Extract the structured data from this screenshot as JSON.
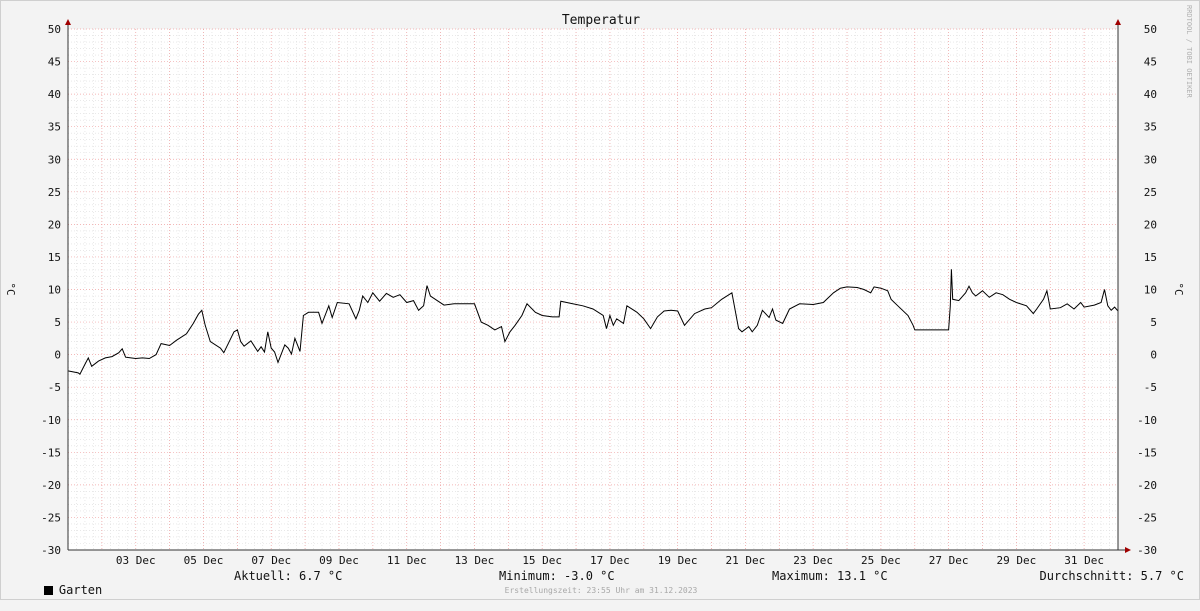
{
  "chart_data": {
    "type": "line",
    "title": "Temperatur",
    "ylabel": "°C",
    "ylim": [
      -30,
      50
    ],
    "yticks": [
      50,
      45,
      40,
      35,
      30,
      25,
      20,
      15,
      10,
      5,
      0,
      -5,
      -10,
      -15,
      -20,
      -25,
      -30
    ],
    "xlim": [
      0,
      31
    ],
    "xticks": [
      {
        "x": 2,
        "label": "03 Dec"
      },
      {
        "x": 4,
        "label": "05 Dec"
      },
      {
        "x": 6,
        "label": "07 Dec"
      },
      {
        "x": 8,
        "label": "09 Dec"
      },
      {
        "x": 10,
        "label": "11 Dec"
      },
      {
        "x": 12,
        "label": "13 Dec"
      },
      {
        "x": 14,
        "label": "15 Dec"
      },
      {
        "x": 16,
        "label": "17 Dec"
      },
      {
        "x": 18,
        "label": "19 Dec"
      },
      {
        "x": 20,
        "label": "21 Dec"
      },
      {
        "x": 22,
        "label": "23 Dec"
      },
      {
        "x": 24,
        "label": "25 Dec"
      },
      {
        "x": 26,
        "label": "27 Dec"
      },
      {
        "x": 28,
        "label": "29 Dec"
      },
      {
        "x": 30,
        "label": "31 Dec"
      }
    ],
    "grid": true,
    "series": [
      {
        "name": "Garten",
        "color": "#000000",
        "points": [
          [
            0.0,
            -2.5
          ],
          [
            0.3,
            -2.8
          ],
          [
            0.35,
            -3.0
          ],
          [
            0.5,
            -1.5
          ],
          [
            0.6,
            -0.5
          ],
          [
            0.7,
            -1.8
          ],
          [
            0.9,
            -1.0
          ],
          [
            1.1,
            -0.5
          ],
          [
            1.3,
            -0.3
          ],
          [
            1.5,
            0.3
          ],
          [
            1.6,
            0.9
          ],
          [
            1.7,
            -0.4
          ],
          [
            2.0,
            -0.6
          ],
          [
            2.2,
            -0.5
          ],
          [
            2.4,
            -0.6
          ],
          [
            2.6,
            0.0
          ],
          [
            2.75,
            1.7
          ],
          [
            3.0,
            1.4
          ],
          [
            3.2,
            2.2
          ],
          [
            3.5,
            3.2
          ],
          [
            3.7,
            4.8
          ],
          [
            3.85,
            6.2
          ],
          [
            3.95,
            6.8
          ],
          [
            4.05,
            4.5
          ],
          [
            4.2,
            2.0
          ],
          [
            4.5,
            1.0
          ],
          [
            4.6,
            0.3
          ],
          [
            4.9,
            3.5
          ],
          [
            5.0,
            3.8
          ],
          [
            5.1,
            2.0
          ],
          [
            5.2,
            1.3
          ],
          [
            5.4,
            2.1
          ],
          [
            5.6,
            0.5
          ],
          [
            5.7,
            1.2
          ],
          [
            5.8,
            0.4
          ],
          [
            5.9,
            3.5
          ],
          [
            6.0,
            1.0
          ],
          [
            6.1,
            0.4
          ],
          [
            6.2,
            -1.2
          ],
          [
            6.4,
            1.5
          ],
          [
            6.5,
            1.0
          ],
          [
            6.6,
            0.1
          ],
          [
            6.7,
            2.5
          ],
          [
            6.85,
            0.5
          ],
          [
            6.95,
            6.0
          ],
          [
            7.1,
            6.5
          ],
          [
            7.4,
            6.5
          ],
          [
            7.5,
            4.8
          ],
          [
            7.7,
            7.5
          ],
          [
            7.8,
            5.7
          ],
          [
            7.95,
            8.0
          ],
          [
            8.3,
            7.8
          ],
          [
            8.5,
            5.5
          ],
          [
            8.6,
            6.8
          ],
          [
            8.7,
            9.0
          ],
          [
            8.85,
            8.0
          ],
          [
            9.0,
            9.5
          ],
          [
            9.2,
            8.2
          ],
          [
            9.4,
            9.4
          ],
          [
            9.6,
            8.8
          ],
          [
            9.8,
            9.2
          ],
          [
            10.0,
            8.0
          ],
          [
            10.2,
            8.3
          ],
          [
            10.35,
            6.8
          ],
          [
            10.5,
            7.5
          ],
          [
            10.6,
            10.6
          ],
          [
            10.7,
            9.0
          ],
          [
            10.9,
            8.3
          ],
          [
            11.1,
            7.6
          ],
          [
            11.4,
            7.8
          ],
          [
            11.7,
            7.8
          ],
          [
            12.0,
            7.8
          ],
          [
            12.2,
            5.0
          ],
          [
            12.4,
            4.5
          ],
          [
            12.6,
            3.8
          ],
          [
            12.8,
            4.3
          ],
          [
            12.9,
            2.0
          ],
          [
            13.05,
            3.5
          ],
          [
            13.2,
            4.5
          ],
          [
            13.4,
            6.0
          ],
          [
            13.55,
            7.8
          ],
          [
            13.8,
            6.5
          ],
          [
            14.0,
            6.0
          ],
          [
            14.3,
            5.8
          ],
          [
            14.5,
            5.8
          ],
          [
            14.55,
            8.2
          ],
          [
            14.9,
            7.8
          ],
          [
            15.2,
            7.5
          ],
          [
            15.5,
            7.0
          ],
          [
            15.8,
            6.0
          ],
          [
            15.9,
            4.0
          ],
          [
            16.0,
            6.0
          ],
          [
            16.1,
            4.5
          ],
          [
            16.2,
            5.5
          ],
          [
            16.4,
            4.8
          ],
          [
            16.5,
            7.5
          ],
          [
            16.8,
            6.5
          ],
          [
            17.0,
            5.5
          ],
          [
            17.2,
            4.0
          ],
          [
            17.4,
            5.8
          ],
          [
            17.6,
            6.7
          ],
          [
            17.8,
            6.8
          ],
          [
            18.0,
            6.7
          ],
          [
            18.2,
            4.5
          ],
          [
            18.5,
            6.3
          ],
          [
            18.8,
            7.0
          ],
          [
            19.0,
            7.2
          ],
          [
            19.3,
            8.5
          ],
          [
            19.6,
            9.5
          ],
          [
            19.8,
            4.0
          ],
          [
            19.9,
            3.5
          ],
          [
            20.1,
            4.3
          ],
          [
            20.2,
            3.5
          ],
          [
            20.35,
            4.5
          ],
          [
            20.5,
            6.8
          ],
          [
            20.7,
            5.7
          ],
          [
            20.8,
            7.0
          ],
          [
            20.9,
            5.3
          ],
          [
            21.1,
            4.8
          ],
          [
            21.3,
            7.0
          ],
          [
            21.6,
            7.8
          ],
          [
            22.0,
            7.7
          ],
          [
            22.3,
            8.0
          ],
          [
            22.6,
            9.5
          ],
          [
            22.8,
            10.2
          ],
          [
            23.0,
            10.4
          ],
          [
            23.3,
            10.3
          ],
          [
            23.5,
            10.0
          ],
          [
            23.7,
            9.5
          ],
          [
            23.8,
            10.4
          ],
          [
            24.0,
            10.2
          ],
          [
            24.2,
            9.8
          ],
          [
            24.3,
            8.5
          ],
          [
            24.5,
            7.5
          ],
          [
            24.8,
            6.0
          ],
          [
            24.95,
            4.5
          ],
          [
            25.0,
            3.8
          ],
          [
            25.5,
            3.8
          ],
          [
            26.0,
            3.8
          ],
          [
            26.05,
            7.5
          ],
          [
            26.08,
            13.1
          ],
          [
            26.12,
            8.5
          ],
          [
            26.3,
            8.3
          ],
          [
            26.5,
            9.5
          ],
          [
            26.6,
            10.5
          ],
          [
            26.7,
            9.5
          ],
          [
            26.8,
            9.0
          ],
          [
            27.0,
            9.8
          ],
          [
            27.2,
            8.8
          ],
          [
            27.4,
            9.5
          ],
          [
            27.6,
            9.2
          ],
          [
            27.8,
            8.5
          ],
          [
            28.0,
            8.0
          ],
          [
            28.3,
            7.5
          ],
          [
            28.5,
            6.3
          ],
          [
            28.6,
            7.0
          ],
          [
            28.8,
            8.5
          ],
          [
            28.9,
            9.8
          ],
          [
            29.0,
            7.0
          ],
          [
            29.3,
            7.2
          ],
          [
            29.5,
            7.8
          ],
          [
            29.7,
            7.0
          ],
          [
            29.9,
            8.0
          ],
          [
            30.0,
            7.3
          ],
          [
            30.3,
            7.6
          ],
          [
            30.5,
            8.0
          ],
          [
            30.6,
            10.0
          ],
          [
            30.7,
            7.5
          ],
          [
            30.8,
            6.8
          ],
          [
            30.9,
            7.3
          ],
          [
            31.0,
            6.7
          ]
        ]
      }
    ]
  },
  "footer": {
    "legend_label": "Garten",
    "current": "Aktuell: 6.7 °C",
    "minimum": "Minimum: -3.0 °C",
    "maximum": "Maximum: 13.1 °C",
    "average": "Durchschnitt: 5.7 °C",
    "created": "Erstellungszeit: 23:55 Uhr am 31.12.2023"
  },
  "watermark": "RRDTOOL / TOBI OETIKER"
}
